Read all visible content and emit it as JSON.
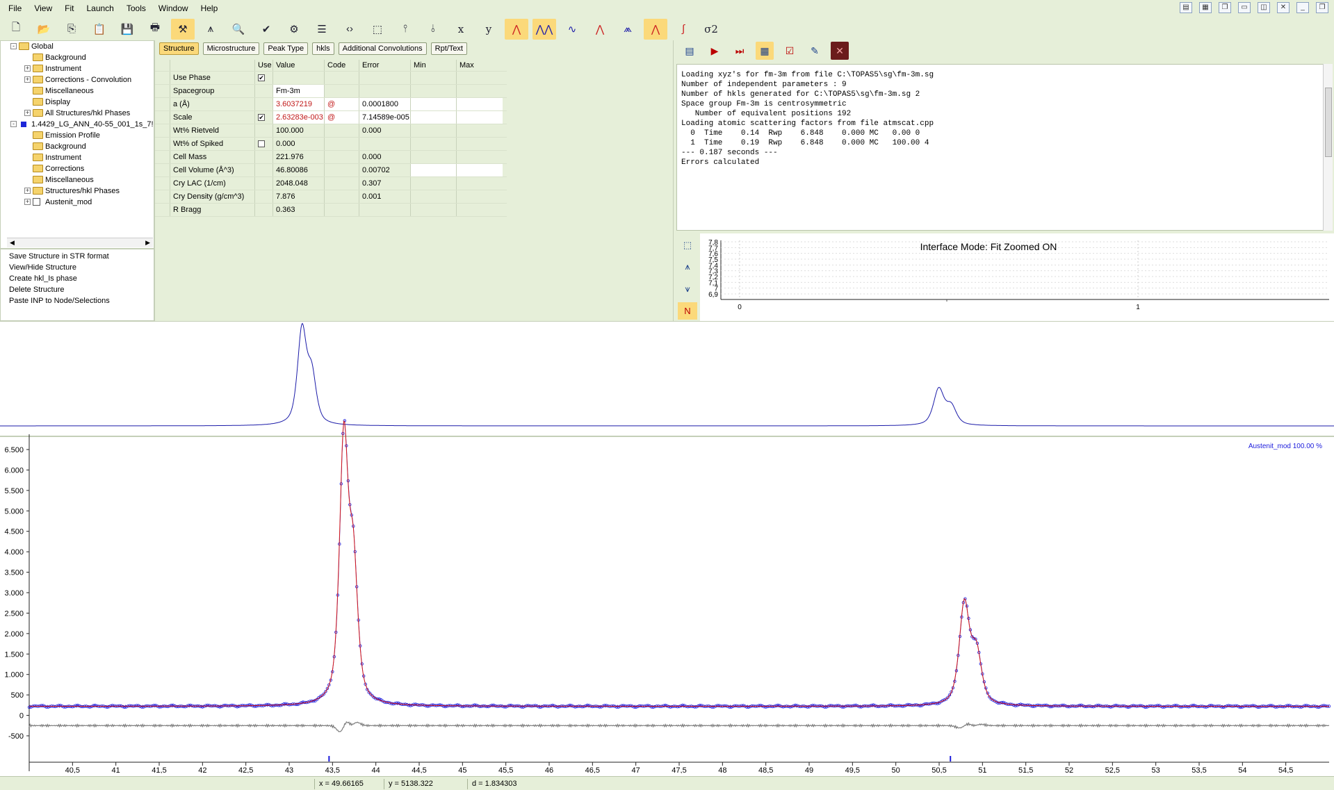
{
  "menu": [
    "File",
    "View",
    "Fit",
    "Launch",
    "Tools",
    "Window",
    "Help"
  ],
  "toolbar_icons": [
    "new-file-icon",
    "open-folder-icon",
    "copy-icon",
    "paste-icon",
    "save-icon",
    "print-icon",
    "refine-icon",
    "peak-icon",
    "zoom-icon",
    "check-icon",
    "fit-icon",
    "ruler-icon",
    "swap-icon",
    "frame-icon",
    "peaks-icon",
    "peaks-edit-icon",
    "x-axis-icon",
    "y-axis-icon",
    "pattern-a-icon",
    "pattern-b-icon",
    "pattern-c-icon",
    "pattern-d-icon",
    "pattern-e-icon",
    "pattern-f-icon",
    "curve-icon",
    "sigma-icon"
  ],
  "toolbar_text": {
    "x": "x",
    "y": "y",
    "sigma": "σ2"
  },
  "tree": [
    {
      "label": "Global",
      "level": 0,
      "exp": "-",
      "icon": "folder"
    },
    {
      "label": "Background",
      "level": 1,
      "exp": "",
      "icon": "folder"
    },
    {
      "label": "Instrument",
      "level": 1,
      "exp": "+",
      "icon": "folder"
    },
    {
      "label": "Corrections - Convolution",
      "level": 1,
      "exp": "+",
      "icon": "folder"
    },
    {
      "label": "Miscellaneous",
      "level": 1,
      "exp": "",
      "icon": "folder"
    },
    {
      "label": "Display",
      "level": 1,
      "exp": "",
      "icon": "folder"
    },
    {
      "label": "All Structures/hkl Phases",
      "level": 1,
      "exp": "+",
      "icon": "folder"
    },
    {
      "label": "1.4429_LG_ANN_40-55_001_1s_7!",
      "level": 0,
      "exp": "-",
      "icon": "phase"
    },
    {
      "label": "Emission Profile",
      "level": 1,
      "exp": "",
      "icon": "folder"
    },
    {
      "label": "Background",
      "level": 1,
      "exp": "",
      "icon": "folder"
    },
    {
      "label": "Instrument",
      "level": 1,
      "exp": "",
      "icon": "folder"
    },
    {
      "label": "Corrections",
      "level": 1,
      "exp": "",
      "icon": "folder"
    },
    {
      "label": "Miscellaneous",
      "level": 1,
      "exp": "",
      "icon": "folder"
    },
    {
      "label": "Structures/hkl Phases",
      "level": 1,
      "exp": "+",
      "icon": "folder"
    },
    {
      "label": "Austenit_mod",
      "level": 1,
      "exp": "+",
      "icon": "structure"
    }
  ],
  "actions": [
    "Save Structure in STR format",
    "View/Hide Structure",
    "Create hkl_Is phase",
    "Delete Structure",
    "Paste INP to Node/Selections"
  ],
  "tabs": [
    "Structure",
    "Microstructure",
    "Peak Type",
    "hkls",
    "Additional Convolutions",
    "Rpt/Text"
  ],
  "grid": {
    "headers": {
      "use": "Use",
      "value": "Value",
      "code": "Code",
      "error": "Error",
      "min": "Min",
      "max": "Max"
    },
    "rows": [
      {
        "name": "Use Phase",
        "use": "checked",
        "value": "",
        "code": "",
        "error": "",
        "min": "",
        "max": ""
      },
      {
        "name": "Spacegroup",
        "use": "",
        "value": "Fm-3m",
        "code": "",
        "error": "",
        "min": "",
        "max": ""
      },
      {
        "name": "a (Å)",
        "use": "",
        "value": "3.6037219",
        "code": "@",
        "error": "0.0001800",
        "min": "",
        "max": ""
      },
      {
        "name": "Scale",
        "use": "checked",
        "value": "2.63283e-003",
        "code": "@",
        "error": "7.14589e-005",
        "min": "",
        "max": ""
      },
      {
        "name": "Wt% Rietveld",
        "use": "",
        "value": "100.000",
        "code": "",
        "error": "0.000",
        "min": "",
        "max": ""
      },
      {
        "name": "Wt% of Spiked",
        "use": "unchecked",
        "value": "0.000",
        "code": "",
        "error": "",
        "min": "",
        "max": ""
      },
      {
        "name": "Cell Mass",
        "use": "",
        "value": "221.976",
        "code": "",
        "error": "0.000",
        "min": "",
        "max": ""
      },
      {
        "name": "Cell Volume (Å^3)",
        "use": "",
        "value": "46.80086",
        "code": "",
        "error": "0.00702",
        "min": "",
        "max": ""
      },
      {
        "name": "Cry LAC (1/cm)",
        "use": "",
        "value": "2048.048",
        "code": "",
        "error": "0.307",
        "min": "",
        "max": ""
      },
      {
        "name": "Cry Density (g/cm^3)",
        "use": "",
        "value": "7.876",
        "code": "",
        "error": "0.001",
        "min": "",
        "max": ""
      },
      {
        "name": "R Bragg",
        "use": "",
        "value": "0.363",
        "code": "",
        "error": "",
        "min": "",
        "max": ""
      }
    ]
  },
  "log_lines": [
    "Loading xyz's for fm-3m from file C:\\TOPAS5\\sg\\fm-3m.sg",
    "Number of independent parameters : 9",
    "Number of hkls generated for C:\\TOPAS5\\sg\\fm-3m.sg 2",
    "Space group Fm-3m is centrosymmetric",
    "   Number of equivalent positions 192",
    "Loading atomic scattering factors from file atmscat.cpp",
    "  0  Time    0.14  Rwp    6.848    0.000 MC   0.00 0",
    "  1  Time    0.19  Rwp    6.848    0.000 MC   100.00 4",
    "--- 0.187 seconds ---",
    "Errors calculated"
  ],
  "mini_chart": {
    "title": "Interface Mode: Fit Zoomed ON",
    "y_ticks": [
      "7,8",
      "7,7",
      "7,6",
      "7,5",
      "7,4",
      "7,3",
      "7,2",
      "7,1",
      "7",
      "6,9"
    ],
    "x_ticks": [
      "0",
      "1"
    ]
  },
  "chart_data": {
    "type": "line",
    "legend": "Austenit_mod   100.00 %",
    "x_ticks": [
      "40,5",
      "41",
      "41,5",
      "42",
      "42,5",
      "43",
      "43,5",
      "44",
      "44,5",
      "45",
      "45,5",
      "46",
      "46,5",
      "47",
      "47,5",
      "48",
      "48,5",
      "49",
      "49,5",
      "50",
      "50,5",
      "51",
      "51,5",
      "52",
      "52,5",
      "53",
      "53,5",
      "54",
      "54,5"
    ],
    "y_ticks": [
      "6.500",
      "6.000",
      "5.500",
      "5.000",
      "4.500",
      "4.000",
      "3.500",
      "3.000",
      "2.500",
      "2.000",
      "1.500",
      "1.000",
      "500",
      "0",
      "-500"
    ],
    "xlim": [
      40.0,
      55.0
    ],
    "ylim": [
      -800,
      6700
    ],
    "peaks": [
      {
        "x": 43.63,
        "height": 6400,
        "width": 0.06
      },
      {
        "x": 43.74,
        "height": 3250,
        "width": 0.06
      },
      {
        "x": 50.79,
        "height": 2450,
        "width": 0.07
      },
      {
        "x": 50.93,
        "height": 1250,
        "width": 0.07
      }
    ],
    "background": 220,
    "difference_offset": -250,
    "hkl_ticks": [
      43.46,
      50.63
    ],
    "series": [
      {
        "name": "",
        "color": "#1a1adc"
      },
      {
        "name": "",
        "color": "#d61818"
      },
      {
        "name": "",
        "color": "#7a7a7a"
      }
    ]
  },
  "status": {
    "x": "x = 49.66165",
    "y": "y = 5138.322",
    "d": "d = 1.834303"
  }
}
